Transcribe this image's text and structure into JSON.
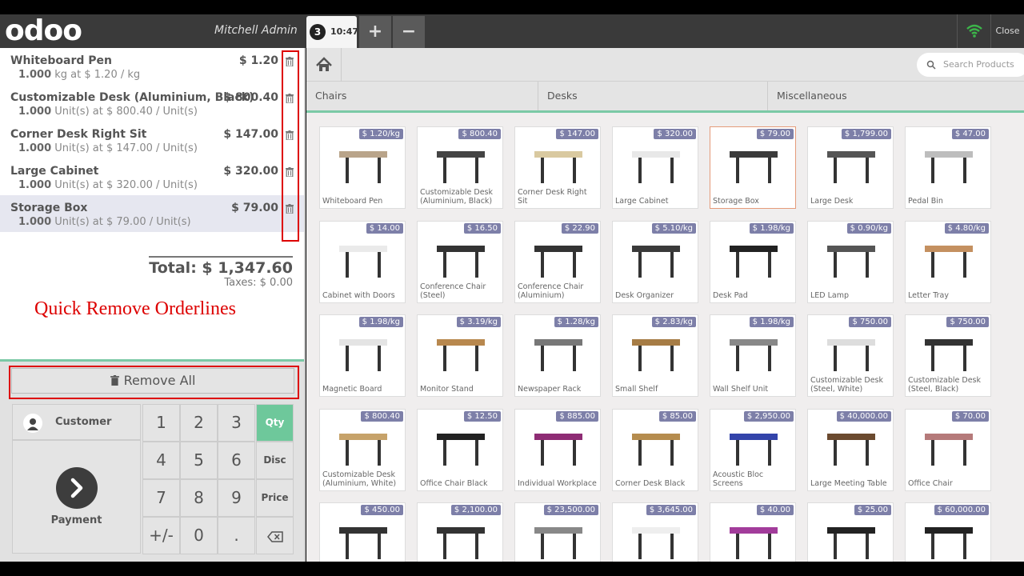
{
  "header": {
    "logo": "odoo",
    "cashier": "Mitchell Admin",
    "order_number": "3",
    "order_time": "10:47",
    "add_label": "+",
    "remove_label": "−",
    "close_label": "Close"
  },
  "orderlines": [
    {
      "name": "Whiteboard Pen",
      "price": "$ 1.20",
      "qty": "1.000",
      "unit_info": "kg at $ 1.20 / kg"
    },
    {
      "name": "Customizable Desk (Aluminium, Black)",
      "price": "$ 800.40",
      "qty": "1.000",
      "unit_info": "Unit(s) at $ 800.40 / Unit(s)"
    },
    {
      "name": "Corner Desk Right Sit",
      "price": "$ 147.00",
      "qty": "1.000",
      "unit_info": "Unit(s) at $ 147.00 / Unit(s)"
    },
    {
      "name": "Large Cabinet",
      "price": "$ 320.00",
      "qty": "1.000",
      "unit_info": "Unit(s) at $ 320.00 / Unit(s)"
    },
    {
      "name": "Storage Box",
      "price": "$ 79.00",
      "qty": "1.000",
      "unit_info": "Unit(s) at $ 79.00 / Unit(s)"
    }
  ],
  "summary": {
    "total": "Total: $ 1,347.60",
    "taxes": "Taxes: $ 0.00"
  },
  "annotation": "Quick Remove Orderlines",
  "pad": {
    "remove_all": "Remove All",
    "customer": "Customer",
    "payment": "Payment",
    "keys": {
      "k1": "1",
      "k2": "2",
      "k3": "3",
      "k4": "4",
      "k5": "5",
      "k6": "6",
      "k7": "7",
      "k8": "8",
      "k9": "9",
      "k0": "0",
      "pm": "+/-",
      "dot": ".",
      "qty": "Qty",
      "disc": "Disc",
      "price": "Price"
    }
  },
  "search": {
    "placeholder": "Search Products"
  },
  "categories": [
    "Chairs",
    "Desks",
    "Miscellaneous"
  ],
  "products": [
    {
      "name": "Whiteboard Pen",
      "price": "$ 1.20/kg"
    },
    {
      "name": "Customizable Desk (Aluminium, Black)",
      "price": "$ 800.40"
    },
    {
      "name": "Corner Desk Right Sit",
      "price": "$ 147.00"
    },
    {
      "name": "Large Cabinet",
      "price": "$ 320.00"
    },
    {
      "name": "Storage Box",
      "price": "$ 79.00"
    },
    {
      "name": "Large Desk",
      "price": "$ 1,799.00"
    },
    {
      "name": "Pedal Bin",
      "price": "$ 47.00"
    },
    {
      "name": "Cabinet with Doors",
      "price": "$ 14.00"
    },
    {
      "name": "Conference Chair (Steel)",
      "price": "$ 16.50"
    },
    {
      "name": "Conference Chair (Aluminium)",
      "price": "$ 22.90"
    },
    {
      "name": "Desk Organizer",
      "price": "$ 5.10/kg"
    },
    {
      "name": "Desk Pad",
      "price": "$ 1.98/kg"
    },
    {
      "name": "LED Lamp",
      "price": "$ 0.90/kg"
    },
    {
      "name": "Letter Tray",
      "price": "$ 4.80/kg"
    },
    {
      "name": "Magnetic Board",
      "price": "$ 1.98/kg"
    },
    {
      "name": "Monitor Stand",
      "price": "$ 3.19/kg"
    },
    {
      "name": "Newspaper Rack",
      "price": "$ 1.28/kg"
    },
    {
      "name": "Small Shelf",
      "price": "$ 2.83/kg"
    },
    {
      "name": "Wall Shelf Unit",
      "price": "$ 1.98/kg"
    },
    {
      "name": "Customizable Desk (Steel, White)",
      "price": "$ 750.00"
    },
    {
      "name": "Customizable Desk (Steel, Black)",
      "price": "$ 750.00"
    },
    {
      "name": "Customizable Desk (Aluminium, White)",
      "price": "$ 800.40"
    },
    {
      "name": "Office Chair Black",
      "price": "$ 12.50"
    },
    {
      "name": "Individual Workplace",
      "price": "$ 885.00"
    },
    {
      "name": "Corner Desk Black",
      "price": "$ 85.00"
    },
    {
      "name": "Acoustic Bloc Screens",
      "price": "$ 2,950.00"
    },
    {
      "name": "Large Meeting Table",
      "price": "$ 40,000.00"
    },
    {
      "name": "Office Chair",
      "price": "$ 70.00"
    },
    {
      "name": "",
      "price": "$ 450.00"
    },
    {
      "name": "",
      "price": "$ 2,100.00"
    },
    {
      "name": "",
      "price": "$ 23,500.00"
    },
    {
      "name": "",
      "price": "$ 3,645.00"
    },
    {
      "name": "",
      "price": "$ 40.00"
    },
    {
      "name": "",
      "price": "$ 25.00"
    },
    {
      "name": "",
      "price": "$ 60,000.00"
    }
  ]
}
